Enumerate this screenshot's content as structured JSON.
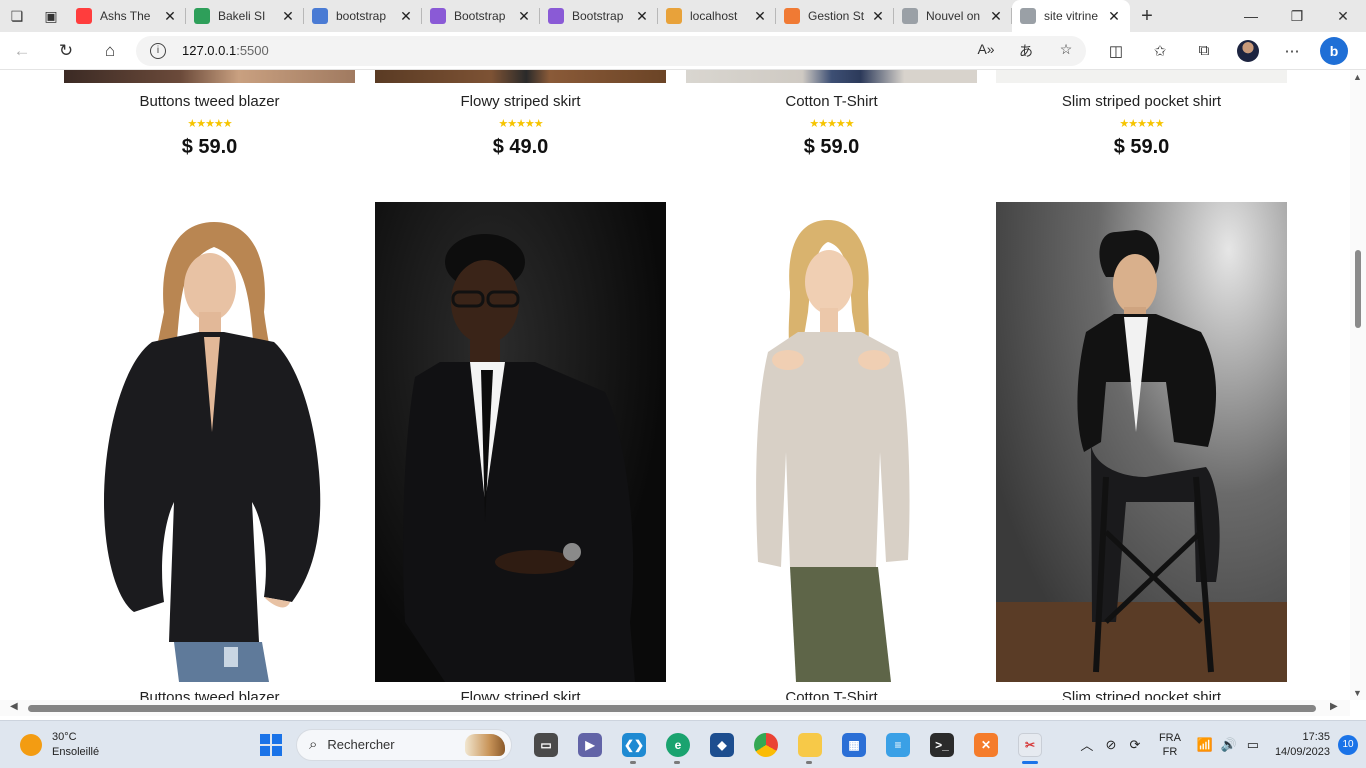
{
  "browser": {
    "tabs": [
      {
        "title": "Ashs The",
        "favicon": "youtube-icon",
        "color": "#ff3d3d"
      },
      {
        "title": "Bakeli SI",
        "favicon": "bakeli-icon",
        "color": "#2e9f5a"
      },
      {
        "title": "bootstrap",
        "favicon": "search-icon",
        "color": "#4a7bd4"
      },
      {
        "title": "Bootstrap",
        "favicon": "bootstrap-icon",
        "color": "#8a5ad6"
      },
      {
        "title": "Bootstrap",
        "favicon": "bootstrap-icon",
        "color": "#8a5ad6"
      },
      {
        "title": "localhost",
        "favicon": "phpmyadmin-icon",
        "color": "#e8a23a"
      },
      {
        "title": "Gestion St",
        "favicon": "xampp-icon",
        "color": "#f07a34"
      },
      {
        "title": "Nouvel on",
        "favicon": "page-icon",
        "color": "#9aa0a6"
      },
      {
        "title": "site vitrine",
        "favicon": "page-icon",
        "color": "#9aa0a6"
      }
    ],
    "address": {
      "host": "127.0.0.1",
      "port": ":5500"
    }
  },
  "products_top": [
    {
      "name": "Buttons tweed blazer",
      "rating": 5,
      "price": "$ 59.0"
    },
    {
      "name": "Flowy striped skirt",
      "rating": 5,
      "price": "$ 49.0"
    },
    {
      "name": "Cotton T-Shirt",
      "rating": 5,
      "price": "$ 59.0"
    },
    {
      "name": "Slim striped pocket shirt",
      "rating": 5,
      "price": "$ 59.0"
    }
  ],
  "products_bottom": [
    {
      "name": "Buttons tweed blazer"
    },
    {
      "name": "Flowy striped skirt"
    },
    {
      "name": "Cotton T-Shirt"
    },
    {
      "name": "Slim striped pocket shirt"
    }
  ],
  "stars_text": "★★★★★",
  "taskbar": {
    "weather_temp": "30°C",
    "weather_desc": "Ensoleillé",
    "search_placeholder": "Rechercher",
    "lang_top": "FRA",
    "lang_bottom": "FR",
    "time": "17:35",
    "date": "14/09/2023",
    "notification_count": "10"
  }
}
